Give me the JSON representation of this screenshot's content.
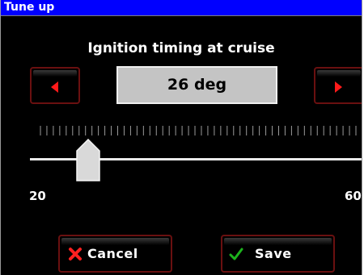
{
  "window": {
    "title": "Tune up"
  },
  "setting": {
    "title": "Ignition timing at cruise",
    "value_display": "26 deg",
    "value": 26,
    "min": 20,
    "max": 60,
    "min_label": "20",
    "max_label": "60"
  },
  "buttons": {
    "cancel_label": "Cancel",
    "save_label": "Save",
    "decrease_icon": "arrow-left-icon",
    "increase_icon": "arrow-right-icon",
    "cancel_icon": "x-icon",
    "save_icon": "checkmark-icon"
  },
  "colors": {
    "titlebar": "#0000ff",
    "background": "#000000",
    "button_border": "#6a1010",
    "arrow": "#ff1a1a",
    "cancel_icon": "#ff2020",
    "save_icon": "#1db31d",
    "value_box": "#c4c4c4"
  }
}
